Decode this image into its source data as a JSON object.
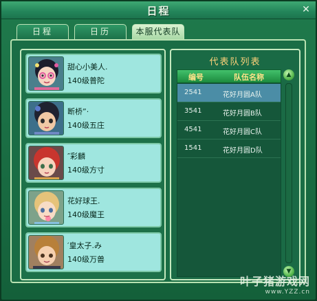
{
  "window": {
    "title": "日程"
  },
  "tabs": [
    {
      "label": "日程"
    },
    {
      "label": "日历"
    },
    {
      "label": "本服代表队",
      "active": true
    }
  ],
  "players": [
    {
      "name": "甜心小美人.",
      "level": "140级普陀"
    },
    {
      "name": "断桥”·",
      "level": "140级五庄"
    },
    {
      "name": "″彩麟",
      "level": "140级方寸"
    },
    {
      "name": "花好球王.",
      "level": "140级魔王"
    },
    {
      "name": "′皇太子.み",
      "level": "140级万兽"
    }
  ],
  "team_list": {
    "title": "代表队列表",
    "columns": [
      "编号",
      "队伍名称"
    ],
    "rows": [
      {
        "code": "2541",
        "team": "花好月圆A队",
        "selected": true
      },
      {
        "code": "3541",
        "team": "花好月圆B队"
      },
      {
        "code": "4541",
        "team": "花好月圆C队"
      },
      {
        "code": "1541",
        "team": "花好月圆D队"
      }
    ]
  },
  "watermark": {
    "main": "叶子猪游戏网",
    "sub": "www.YZZ.cn"
  },
  "colors": {
    "accent": "#ffd27a",
    "card_bg": "#9fe6df",
    "selected_row": "#4b8da6"
  }
}
